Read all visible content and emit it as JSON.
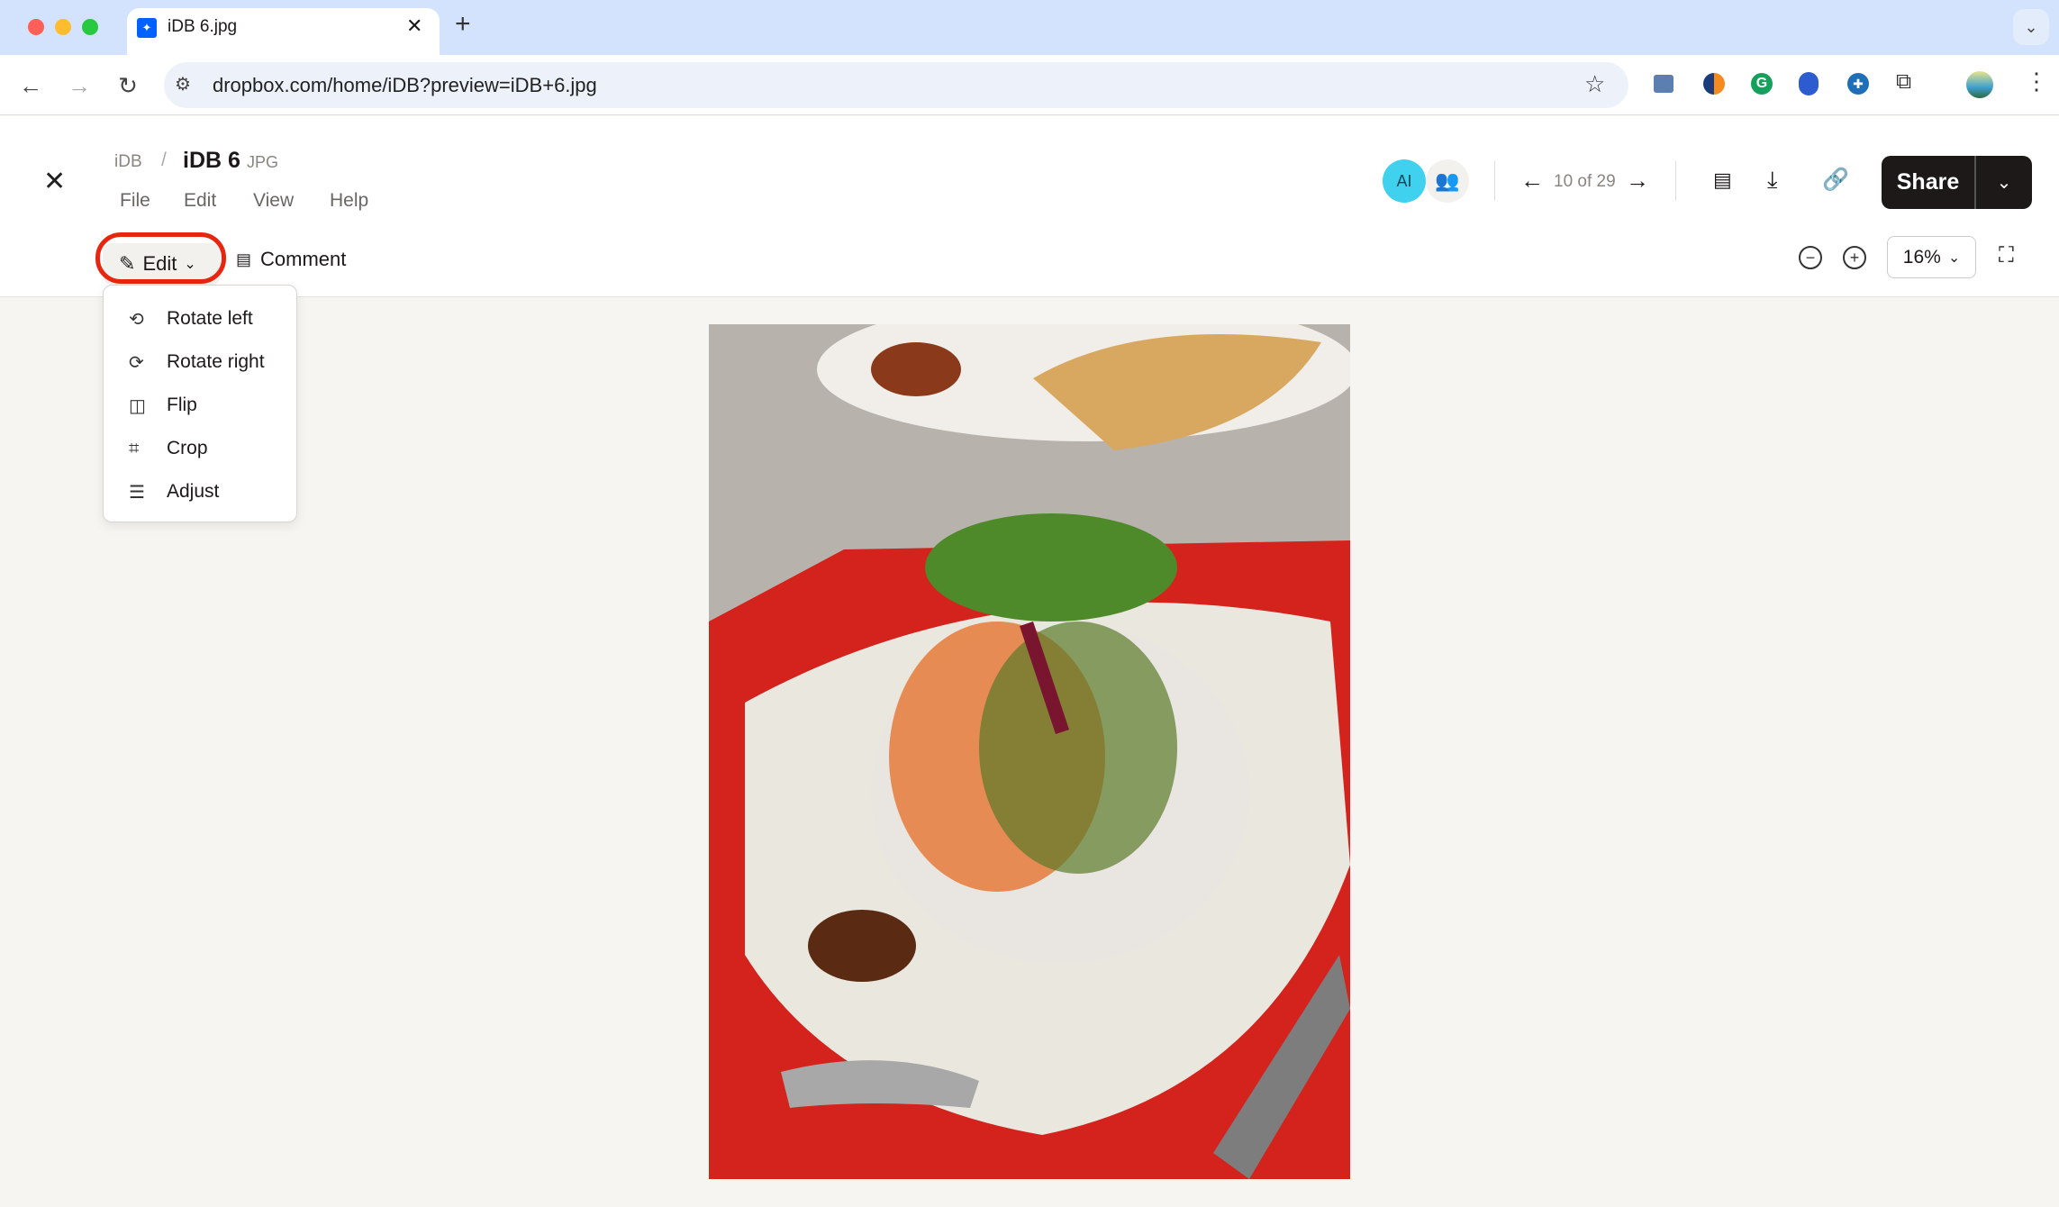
{
  "browser": {
    "tab_title": "iDB 6.jpg",
    "url": "dropbox.com/home/iDB?preview=iDB+6.jpg",
    "colors": {
      "close": "#ff5f57",
      "minimize": "#febc2e",
      "maximize": "#28c840"
    }
  },
  "header": {
    "breadcrumb_parent": "iDB",
    "separator": "/",
    "file_name": "iDB 6",
    "file_ext": "JPG",
    "menu": [
      "File",
      "Edit",
      "View",
      "Help"
    ],
    "ai_label": "AI",
    "pager": "10 of 29",
    "share_label": "Share"
  },
  "toolbar": {
    "edit_label": "Edit",
    "comment_label": "Comment",
    "zoom_value": "16%"
  },
  "edit_menu": [
    {
      "label": "Rotate left",
      "icon": "rotate-left-icon"
    },
    {
      "label": "Rotate right",
      "icon": "rotate-right-icon"
    },
    {
      "label": "Flip",
      "icon": "flip-icon"
    },
    {
      "label": "Crop",
      "icon": "crop-icon"
    },
    {
      "label": "Adjust",
      "icon": "adjust-icon"
    }
  ],
  "colors": {
    "accent_ring": "#e8260f",
    "ai_badge": "#3fd1ee",
    "share_bg": "#1e1919",
    "page_bg": "#f7f5f2"
  }
}
